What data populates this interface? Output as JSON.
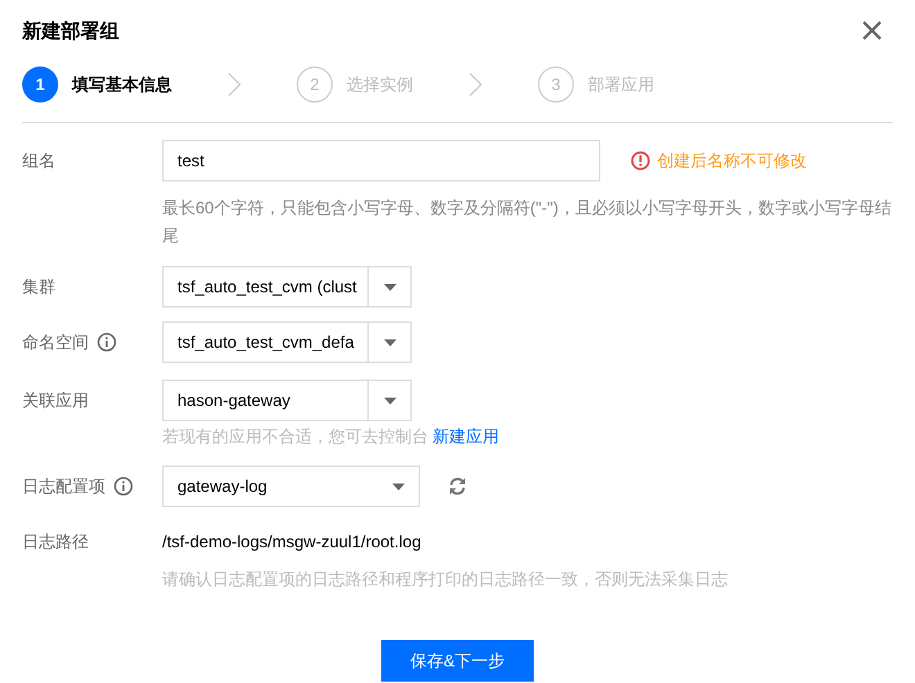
{
  "dialog": {
    "title": "新建部署组"
  },
  "steps": [
    {
      "number": "1",
      "label": "填写基本信息",
      "selected": true
    },
    {
      "number": "2",
      "label": "选择实例",
      "selected": false
    },
    {
      "number": "3",
      "label": "部署应用",
      "selected": false
    }
  ],
  "form": {
    "group_name": {
      "label": "组名",
      "value": "test",
      "warning": "创建后名称不可修改",
      "hint": "最长60个字符，只能包含小写字母、数字及分隔符(\"-\")，且必须以小写字母开头，数字或小写字母结尾"
    },
    "cluster": {
      "label": "集群",
      "value": "tsf_auto_test_cvm (clust"
    },
    "namespace": {
      "label": "命名空间",
      "value": "tsf_auto_test_cvm_defa"
    },
    "application": {
      "label": "关联应用",
      "value": "hason-gateway",
      "hint": "若现有的应用不合适，您可去控制台",
      "link": "新建应用"
    },
    "log_config": {
      "label": "日志配置项",
      "value": "gateway-log"
    },
    "log_path": {
      "label": "日志路径",
      "value": "/tsf-demo-logs/msgw-zuul1/root.log",
      "hint": "请确认日志配置项的日志路径和程序打印的日志路径一致，否则无法采集日志"
    }
  },
  "buttons": {
    "primary": "保存&下一步"
  }
}
